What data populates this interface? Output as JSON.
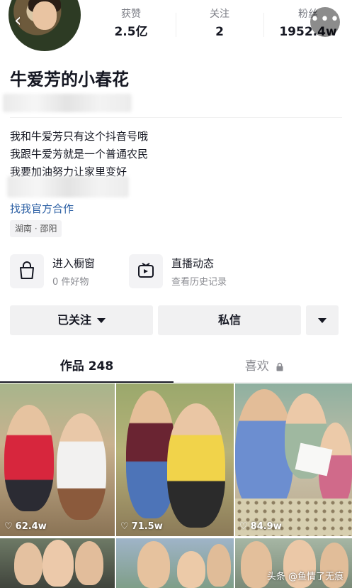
{
  "header": {
    "stats": [
      {
        "label": "获赞",
        "value": "2.5亿"
      },
      {
        "label": "关注",
        "value": "2"
      },
      {
        "label": "粉丝",
        "value": "1952.4w"
      }
    ],
    "more_icon": "ellipsis-icon",
    "back_icon": "chevron-left-icon"
  },
  "profile": {
    "name": "牛爱芳的小春花",
    "bio": [
      "我和牛爱芳只有这个抖音号哦",
      "我跟牛爱芳就是一个普通农民",
      "我要加油努力让家里变好"
    ],
    "link": "找我官方合作",
    "location": "湖南 · 邵阳"
  },
  "features": [
    {
      "title": "进入橱窗",
      "sub": "0 件好物",
      "icon": "shopping-bag-icon"
    },
    {
      "title": "直播动态",
      "sub": "查看历史记录",
      "icon": "live-tv-icon"
    }
  ],
  "actions": {
    "follow": "已关注",
    "message": "私信"
  },
  "tabs": {
    "works": "作品 248",
    "likes": "喜欢"
  },
  "videos": [
    {
      "likes": "62.4w"
    },
    {
      "likes": "71.5w"
    },
    {
      "likes": "84.9w"
    }
  ],
  "watermark": "头条 @鱼情了无痕",
  "colors": {
    "link": "#2a5ea3",
    "text": "#161823"
  }
}
